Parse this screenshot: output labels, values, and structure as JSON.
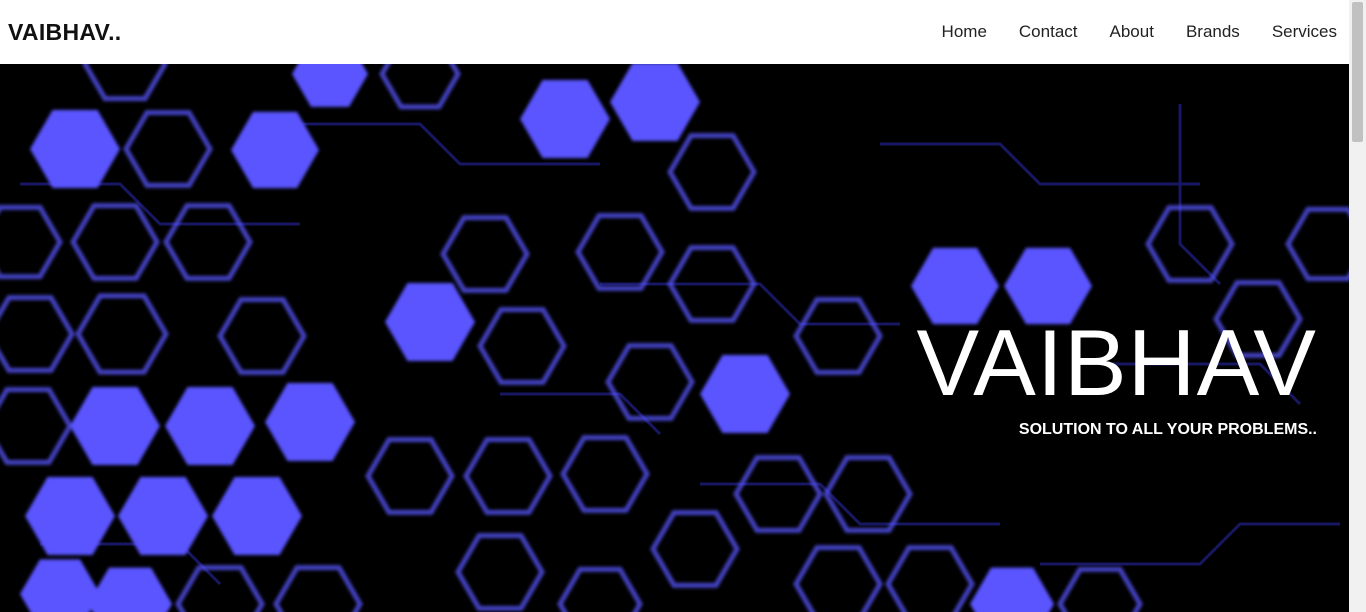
{
  "navbar": {
    "brand": "VAIBHAV..",
    "links": [
      "Home",
      "Contact",
      "About",
      "Brands",
      "Services"
    ]
  },
  "hero": {
    "title": "VAIBHAV",
    "tagline": "SOLUTION TO ALL YOUR PROBLEMS..",
    "background_image": "circuit-hexagon-pattern",
    "accent_color": "#5a55ff"
  }
}
